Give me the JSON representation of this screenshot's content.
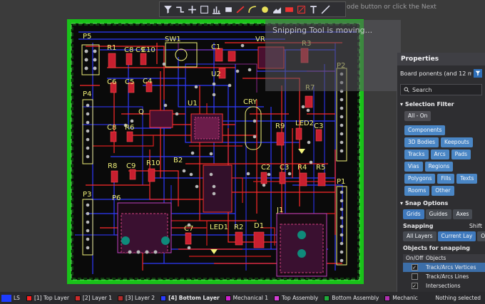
{
  "toolbar": {
    "tools": [
      "filter-icon",
      "route-icon",
      "plus-icon",
      "rect-select-icon",
      "chart-icon",
      "component-icon",
      "track-icon",
      "arc-icon",
      "via-icon",
      "region-icon",
      "fill-icon",
      "drc-icon",
      "text-icon",
      "measure-icon"
    ]
  },
  "snip_ghost": {
    "top_text": "ode button or click the Next",
    "title": "Snipping Tool is moving..."
  },
  "pcb": {
    "designators": [
      "P5",
      "R1",
      "C8",
      "C9",
      "C10",
      "SW1",
      "C1",
      "VR",
      "R3",
      "P2",
      "U2",
      "C6",
      "C5",
      "C4",
      "R7",
      "P4",
      "Q",
      "U1",
      "CRY",
      "LED2",
      "C3",
      "R9",
      "C8",
      "R6",
      "B2",
      "C2",
      "C3",
      "R4",
      "R5",
      "R8",
      "C9",
      "R10",
      "P3",
      "P6",
      "P1",
      "J1",
      "LED1",
      "R2",
      "D1",
      "C7"
    ]
  },
  "properties": {
    "title": "Properties",
    "board_label": "Board",
    "board_summary": "ponents (and 12 more)",
    "search_placeholder": "Search",
    "selection_filter": {
      "heading": "Selection Filter",
      "all_on": "All - On",
      "chips": [
        "Components",
        "3D Bodies",
        "Keepouts",
        "Tracks",
        "Arcs",
        "Pads",
        "Vias",
        "Regions",
        "Polygons",
        "Fills",
        "Texts",
        "Rooms",
        "Other"
      ]
    },
    "snap_options": {
      "heading": "Snap Options",
      "modes": [
        "Grids",
        "Guides",
        "Axes"
      ],
      "snapping_label": "Snapping",
      "shift_label": "Shift",
      "layers": [
        "All Layers",
        "Current Lay",
        "Off"
      ],
      "objects_label": "Objects for snapping",
      "col_onoff": "On/Off",
      "col_objects": "Objects",
      "rows": [
        {
          "name": "Track/Arcs Vertices",
          "checked": true
        },
        {
          "name": "Track/Arcs Lines",
          "checked": false
        },
        {
          "name": "Intersections",
          "checked": true
        }
      ]
    }
  },
  "layerbar": {
    "ls": "LS",
    "layers": [
      {
        "name": "[1] Top Layer",
        "color": "#ff2020"
      },
      {
        "name": "[2] Layer 1",
        "color": "#cc2a2a"
      },
      {
        "name": "[3] Layer 2",
        "color": "#b02a2a"
      },
      {
        "name": "[4] Bottom Layer",
        "color": "#2a3cff",
        "active": true
      },
      {
        "name": "Mechanical 1",
        "color": "#d020d0"
      },
      {
        "name": "Top Assembly",
        "color": "#d43fd4"
      },
      {
        "name": "Bottom Assembly",
        "color": "#1faa3a"
      },
      {
        "name": "Mechanic",
        "color": "#b030b0"
      }
    ],
    "status": "Nothing selected"
  },
  "colors": {
    "board_outline": "#19c219",
    "board_bg": "#000000",
    "top_copper": "#ff2a2a",
    "bottom_copper": "#2f3aff",
    "silkscreen": "#f2f27a",
    "pads": "#b9b9b9",
    "accent_blue": "#4a86c5"
  }
}
